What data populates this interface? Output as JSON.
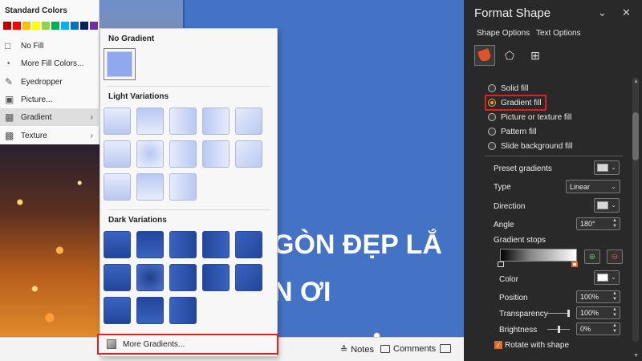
{
  "color_menu": {
    "heading": "Standard Colors",
    "swatches": [
      "#c00000",
      "#ff0000",
      "#ffc000",
      "#ffff00",
      "#92d050",
      "#00b050",
      "#00b0f0",
      "#0070c0",
      "#002060",
      "#7030a0"
    ],
    "items": [
      {
        "label": "No Fill",
        "icon": "no-fill-icon"
      },
      {
        "label": "More Fill Colors...",
        "icon": "palette-icon"
      },
      {
        "label": "Eyedropper",
        "icon": "eyedropper-icon"
      },
      {
        "label": "Picture...",
        "icon": "picture-icon"
      },
      {
        "label": "Gradient",
        "icon": "gradient-icon",
        "arrow": "›"
      },
      {
        "label": "Texture",
        "icon": "texture-icon",
        "arrow": "›"
      }
    ]
  },
  "gradient_panel": {
    "no_gradient_label": "No Gradient",
    "light_label": "Light Variations",
    "dark_label": "Dark Variations",
    "more_label": "More Gradients..."
  },
  "slide": {
    "title_line1": "GÒN ĐẸP LẮ",
    "title_line2": "N ƠI"
  },
  "status_bar": {
    "notes_label": "Notes",
    "comments_label": "Comments"
  },
  "pane": {
    "title": "Format Shape",
    "collapse_glyph": "⌄",
    "close_glyph": "✕",
    "tab_shape": "Shape Options",
    "tab_text": "Text Options",
    "fill_options": [
      {
        "label": "Solid fill",
        "selected": false
      },
      {
        "label": "Gradient fill",
        "selected": true
      },
      {
        "label": "Picture or texture fill",
        "selected": false
      },
      {
        "label": "Pattern fill",
        "selected": false
      },
      {
        "label": "Slide background fill",
        "selected": false
      }
    ],
    "preset_label": "Preset gradients",
    "type_label": "Type",
    "type_value": "Linear",
    "direction_label": "Direction",
    "angle_label": "Angle",
    "angle_value": "180°",
    "stops_label": "Gradient stops",
    "color_label": "Color",
    "position_label": "Position",
    "position_value": "100%",
    "transparency_label": "Transparency",
    "transparency_value": "100%",
    "brightness_label": "Brightness",
    "brightness_value": "0%",
    "rotate_label": "Rotate with shape",
    "rotate_checked": true
  },
  "colors": {
    "slide_blue": "#4472c4",
    "accent_orange": "#f0a030",
    "highlight_red": "#e02020"
  }
}
